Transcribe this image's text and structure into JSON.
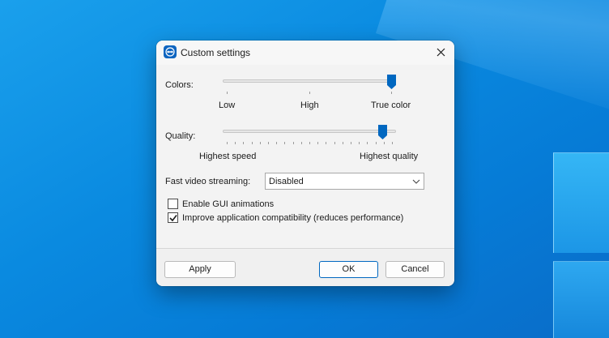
{
  "dialog": {
    "title": "Custom settings",
    "icon": "teamviewer-icon",
    "close_icon": "close-icon"
  },
  "colors": {
    "label": "Colors:",
    "ticks": [
      "Low",
      "High",
      "True color"
    ],
    "selected_index": 2
  },
  "quality": {
    "label": "Quality:",
    "min_label": "Highest speed",
    "max_label": "Highest quality",
    "level_fraction": 0.92
  },
  "streaming": {
    "label": "Fast video streaming:",
    "value": "Disabled"
  },
  "options": [
    {
      "label": "Enable GUI animations",
      "checked": false
    },
    {
      "label": "Improve application compatibility (reduces performance)",
      "checked": true
    }
  ],
  "buttons": {
    "apply": "Apply",
    "ok": "OK",
    "cancel": "Cancel"
  },
  "colors_palette": {
    "accent": "#0067c0",
    "dialog_bg": "#f3f3f3",
    "desktop": "#0a8ae0"
  }
}
